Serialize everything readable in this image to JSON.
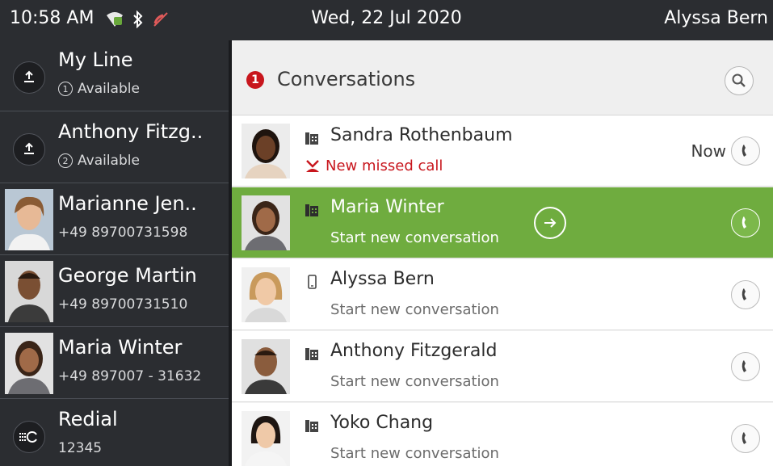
{
  "statusbar": {
    "time": "10:58 AM",
    "date": "Wed, 22 Jul 2020",
    "user": "Alyssa Bern",
    "icons": [
      "network-icon",
      "bluetooth-icon",
      "mute-icon"
    ]
  },
  "sidebar": {
    "items": [
      {
        "name": "My Line",
        "sub": "Available",
        "line_no": "1",
        "icon": "line-key-icon"
      },
      {
        "name": "Anthony Fitzg..",
        "sub": "Available",
        "line_no": "2",
        "icon": "line-key-icon"
      },
      {
        "name": "Marianne Jen..",
        "sub": "+49 89700731598",
        "icon": "contact-photo"
      },
      {
        "name": "George Martin",
        "sub": "+49 89700731510",
        "icon": "contact-photo"
      },
      {
        "name": "Maria Winter",
        "sub": "+49 897007 - 31632",
        "icon": "contact-photo"
      },
      {
        "name": "Redial",
        "sub": "12345",
        "icon": "redial-icon"
      }
    ]
  },
  "main": {
    "badge_count": "1",
    "title": "Conversations",
    "rows": [
      {
        "name": "Sandra Rothenbaum",
        "status": "New missed call",
        "when": "Now",
        "device": "office-phone-icon",
        "missed": true
      },
      {
        "name": "Maria Winter",
        "status": "Start new conversation",
        "device": "office-phone-icon",
        "active": true
      },
      {
        "name": "Alyssa Bern",
        "status": "Start new conversation",
        "device": "mobile-phone-icon"
      },
      {
        "name": "Anthony Fitzgerald",
        "status": "Start new conversation",
        "device": "office-phone-icon"
      },
      {
        "name": "Yoko Chang",
        "status": "Start new conversation",
        "device": "office-phone-icon"
      }
    ]
  },
  "colors": {
    "statusbar_bg": "#2b2d31",
    "active_row": "#6fac3f",
    "missed": "#c8161d"
  }
}
